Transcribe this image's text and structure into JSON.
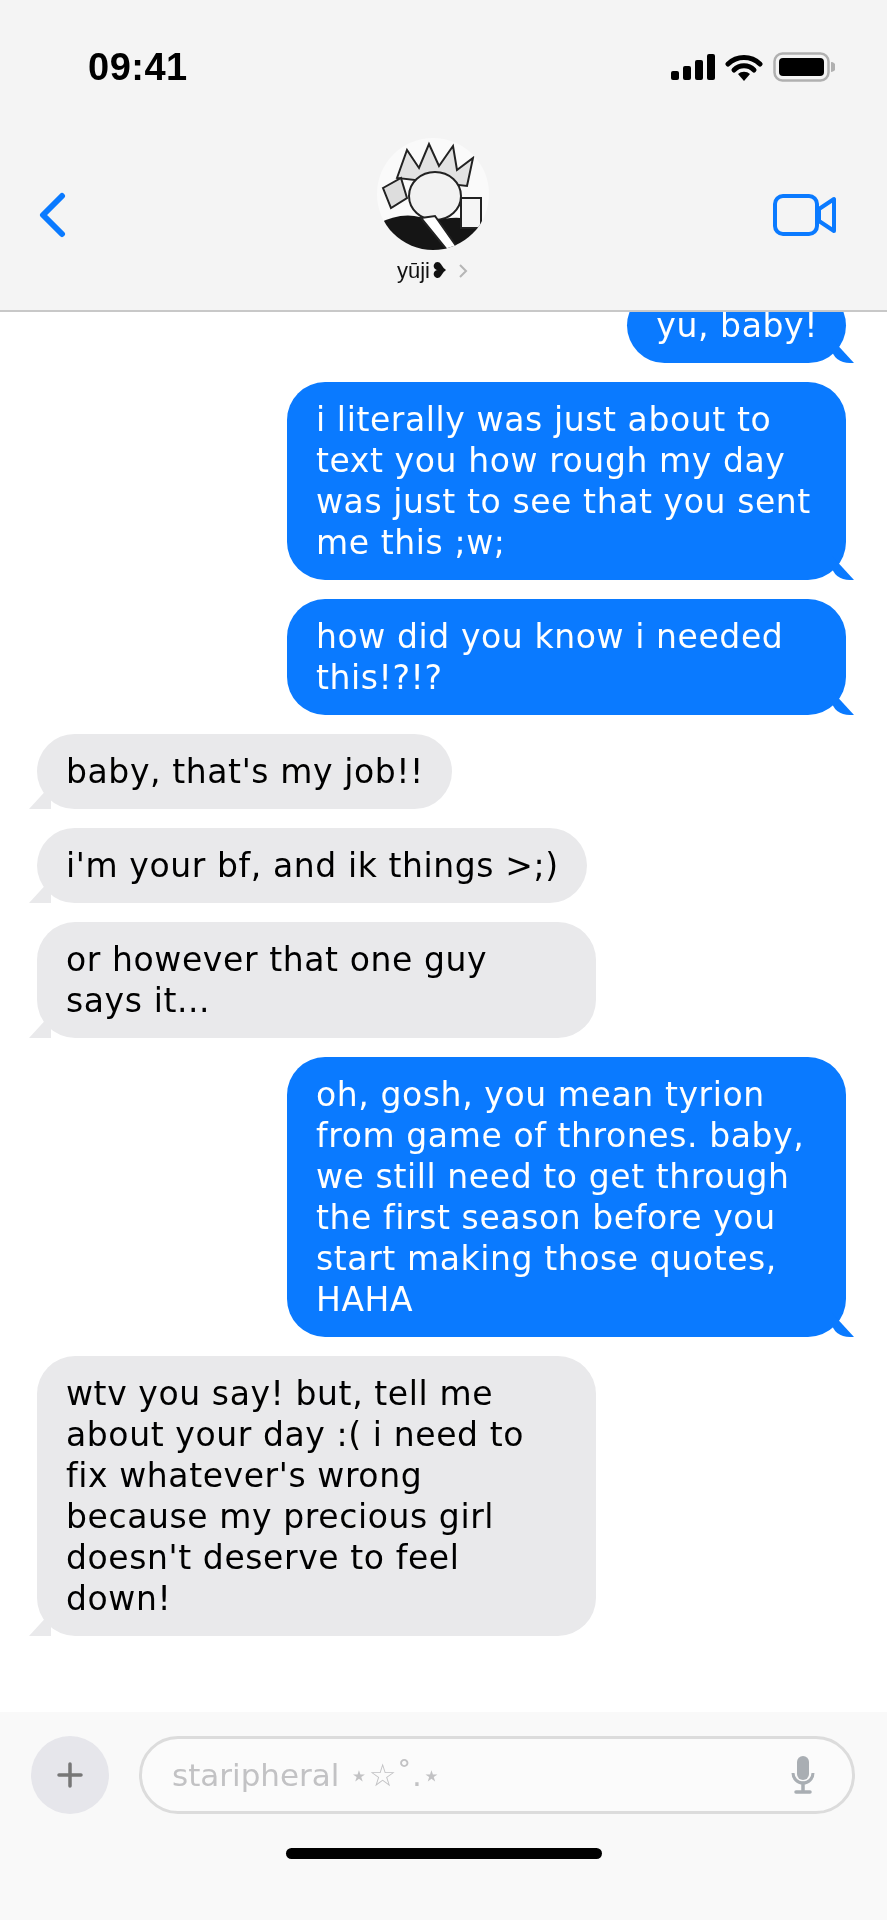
{
  "status_bar": {
    "time": "09:41"
  },
  "header": {
    "contact_name": "yūji❥"
  },
  "messages": [
    {
      "kind": "sent",
      "text": "yu, baby!"
    },
    {
      "kind": "sent",
      "text": "i literally was just about to text you how rough my day was just to see that you sent me this ;w;"
    },
    {
      "kind": "sent",
      "text": "how did you know i needed this!?!?"
    },
    {
      "kind": "received",
      "text": "baby, that's my job!!"
    },
    {
      "kind": "received",
      "text": "i'm your bf, and ik things >;)"
    },
    {
      "kind": "received",
      "text": "or however that one guy says it..."
    },
    {
      "kind": "sent",
      "text": "oh, gosh, you mean tyrion from game of thrones.  baby, we still need to get through the first season before you start making those quotes, HAHA"
    },
    {
      "kind": "received",
      "text": "wtv you say!  but, tell me about your day :( i need to fix whatever's wrong because my precious girl doesn't deserve to feel down!"
    }
  ],
  "composer": {
    "placeholder": "staripheral ⋆☆˚.⋆"
  }
}
